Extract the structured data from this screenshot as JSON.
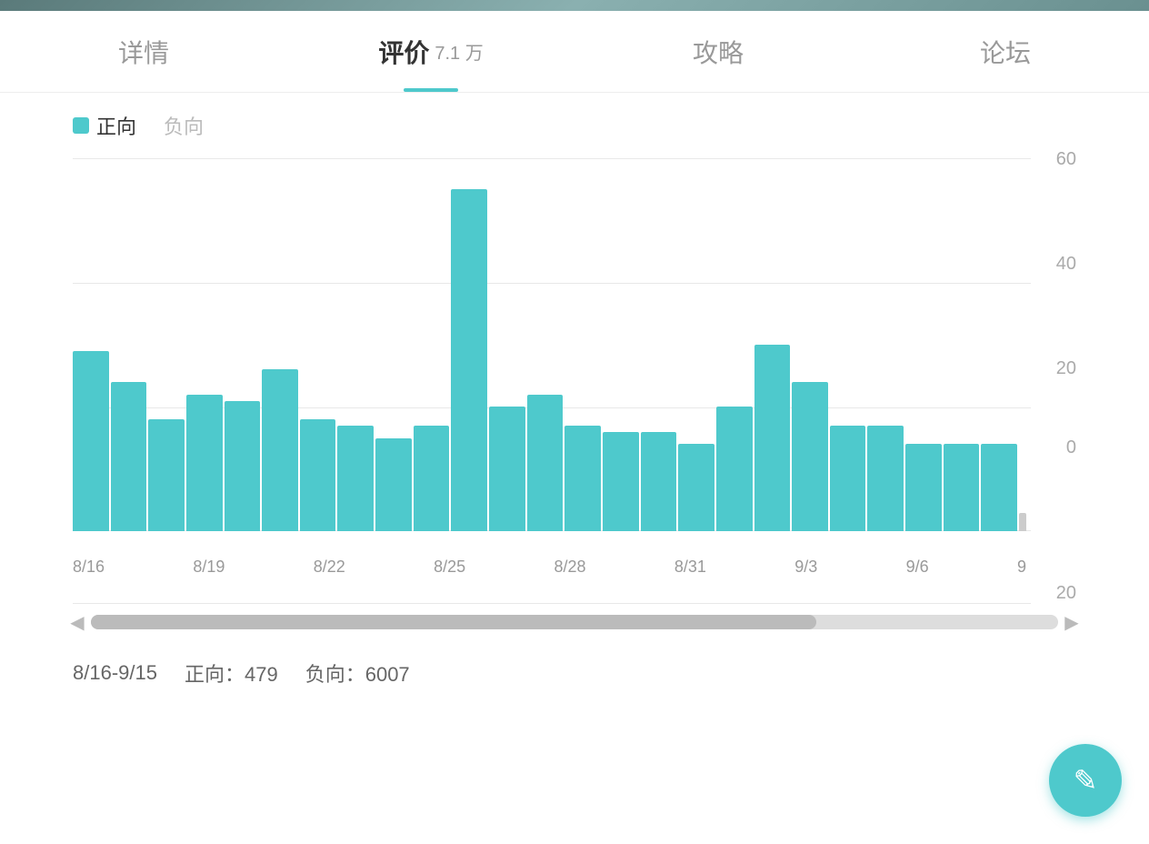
{
  "topBanner": {
    "visible": true
  },
  "tabs": [
    {
      "id": "details",
      "label": "详情",
      "active": false,
      "count": null
    },
    {
      "id": "reviews",
      "label": "评价",
      "active": true,
      "count": "7.1 万"
    },
    {
      "id": "guide",
      "label": "攻略",
      "active": false,
      "count": null
    },
    {
      "id": "forum",
      "label": "论坛",
      "active": false,
      "count": null
    }
  ],
  "legend": {
    "positive": {
      "label": "正向",
      "active": true
    },
    "negative": {
      "label": "负向",
      "active": false
    }
  },
  "yAxis": {
    "labels": [
      "60",
      "40",
      "20",
      "0"
    ],
    "bottomLabel": "20"
  },
  "xAxis": {
    "labels": [
      "8/16",
      "8/19",
      "8/22",
      "8/25",
      "8/28",
      "8/31",
      "9/3",
      "9/6",
      "9"
    ]
  },
  "bars": [
    {
      "date": "8/16",
      "value": 29,
      "maxValue": 55
    },
    {
      "date": "",
      "value": 24,
      "maxValue": 55
    },
    {
      "date": "",
      "value": 18,
      "maxValue": 55
    },
    {
      "date": "8/19",
      "value": 22,
      "maxValue": 55
    },
    {
      "date": "",
      "value": 21,
      "maxValue": 55
    },
    {
      "date": "",
      "value": 26,
      "maxValue": 55
    },
    {
      "date": "8/22",
      "value": 18,
      "maxValue": 55
    },
    {
      "date": "",
      "value": 17,
      "maxValue": 55
    },
    {
      "date": "",
      "value": 15,
      "maxValue": 55
    },
    {
      "date": "8/25",
      "value": 17,
      "maxValue": 55
    },
    {
      "date": "",
      "value": 55,
      "maxValue": 55
    },
    {
      "date": "",
      "value": 20,
      "maxValue": 55
    },
    {
      "date": "8/28",
      "value": 22,
      "maxValue": 55
    },
    {
      "date": "",
      "value": 17,
      "maxValue": 55
    },
    {
      "date": "",
      "value": 16,
      "maxValue": 55
    },
    {
      "date": "8/31",
      "value": 16,
      "maxValue": 55
    },
    {
      "date": "",
      "value": 14,
      "maxValue": 55
    },
    {
      "date": "",
      "value": 20,
      "maxValue": 55
    },
    {
      "date": "9/3",
      "value": 30,
      "maxValue": 55
    },
    {
      "date": "",
      "value": 24,
      "maxValue": 55
    },
    {
      "date": "",
      "value": 17,
      "maxValue": 55
    },
    {
      "date": "9/6",
      "value": 17,
      "maxValue": 55
    },
    {
      "date": "",
      "value": 14,
      "maxValue": 55
    },
    {
      "date": "",
      "value": 14,
      "maxValue": 55
    },
    {
      "date": "9",
      "value": 14,
      "maxValue": 55
    },
    {
      "date": "",
      "value": 3,
      "maxValue": 55
    }
  ],
  "stats": {
    "dateRange": "8/16-9/15",
    "positiveLabel": "正向：",
    "positiveValue": "479",
    "negativeLabel": "负向：",
    "negativeValue": "6007"
  },
  "scrollbar": {
    "leftArrow": "◀",
    "rightArrow": "▶"
  },
  "fab": {
    "icon": "✎"
  }
}
